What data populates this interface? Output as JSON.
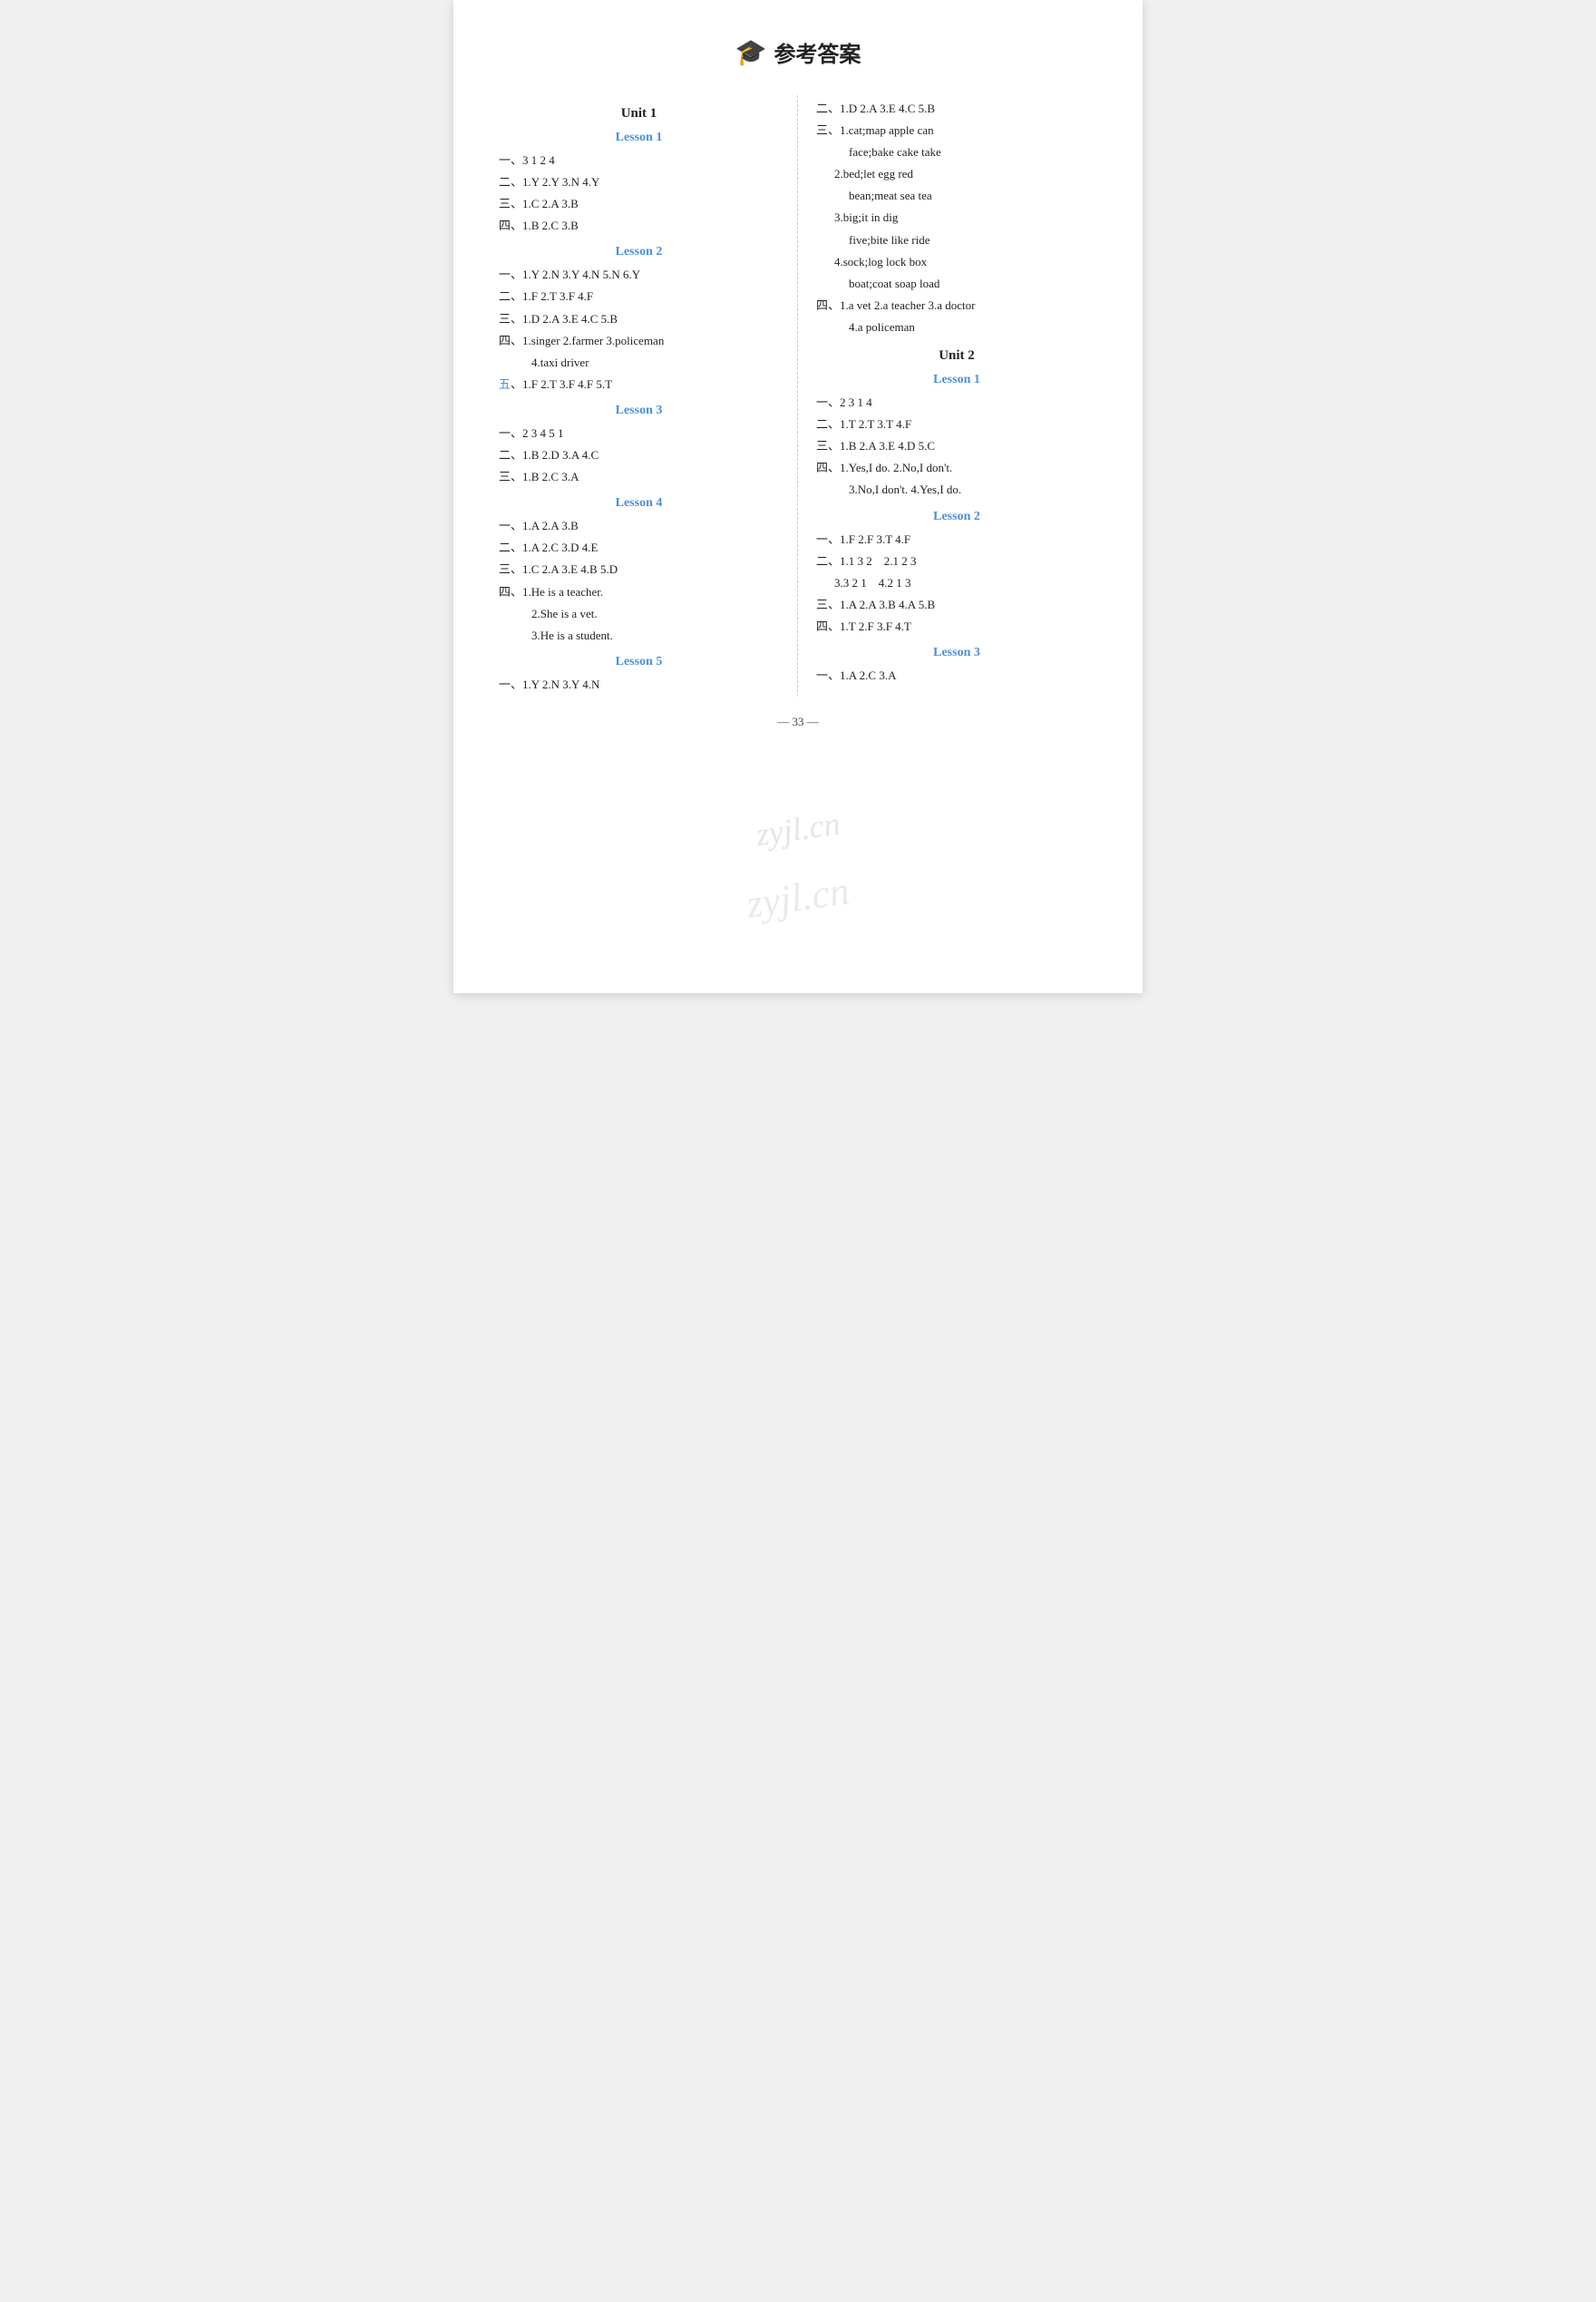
{
  "header": {
    "icon": "🎓",
    "title": "参考答案"
  },
  "left_column": {
    "unit1_title": "Unit 1",
    "lessons": [
      {
        "title": "Lesson 1",
        "answers": [
          "一、3  1  2  4",
          "二、1.Y  2.Y  3.N  4.Y",
          "三、1.C  2.A  3.B",
          "四、1.B  2.C  3.B"
        ]
      },
      {
        "title": "Lesson 2",
        "answers": [
          "一、1.Y  2.N  3.Y  4.N  5.N  6.Y",
          "二、1.F  2.T  3.F  4.F",
          "三、1.D  2.A  3.E  4.C  5.B",
          "四、1.singer  2.farmer  3.policeman",
          "    4.taxi driver",
          "五、1.F  2.T  3.F  4.F  5.T"
        ]
      },
      {
        "title": "Lesson 3",
        "answers": [
          "一、2  3  4  5  1",
          "二、1.B  2.D  3.A  4.C",
          "三、1.B  2.C  3.A"
        ]
      },
      {
        "title": "Lesson 4",
        "answers": [
          "一、1.A  2.A  3.B",
          "二、1.A  2.C  3.D  4.E",
          "三、1.C  2.A  3.E  4.B  5.D",
          "四、1.He is a teacher.",
          "    2.She is a vet.",
          "    3.He is a student."
        ]
      },
      {
        "title": "Lesson 5",
        "answers": [
          "一、1.Y  2.N  3.Y  4.N"
        ]
      }
    ]
  },
  "right_column": {
    "lesson5_continued": [
      "二、1.D  2.A  3.E  4.C  5.B",
      "三、1.cat;map  apple  can",
      "       face;bake  cake  take",
      "    2.bed;let  egg  red",
      "       bean;meat  sea  tea",
      "    3.big;it  in  dig",
      "       five;bite  like  ride",
      "    4.sock;log  lock  box",
      "       boat;coat  soap  load",
      "四、1.a vet  2.a teacher  3.a doctor",
      "    4.a policeman"
    ],
    "unit2_title": "Unit 2",
    "lessons": [
      {
        "title": "Lesson 1",
        "answers": [
          "一、2  3  1  4",
          "二、1.T  2.T  3.T  4.F",
          "三、1.B  2.A  3.E  4.D  5.C",
          "四、1.Yes,I do.  2.No,I don't.",
          "    3.No,I don't.  4.Yes,I do."
        ]
      },
      {
        "title": "Lesson 2",
        "answers": [
          "一、1.F  2.F  3.T  4.F",
          "二、1.1 3 2     2.1 2 3",
          "    3.3 2 1     4.2 1 3",
          "三、1.A  2.A  3.B  4.A  5.B",
          "四、1.T  2.F  3.F  4.T"
        ]
      },
      {
        "title": "Lesson 3",
        "answers": [
          "一、1.A  2.C  3.A"
        ]
      }
    ]
  },
  "page_number": "— 33 —",
  "watermark1": "zyjl.cn",
  "watermark2": "zyjl.cn"
}
